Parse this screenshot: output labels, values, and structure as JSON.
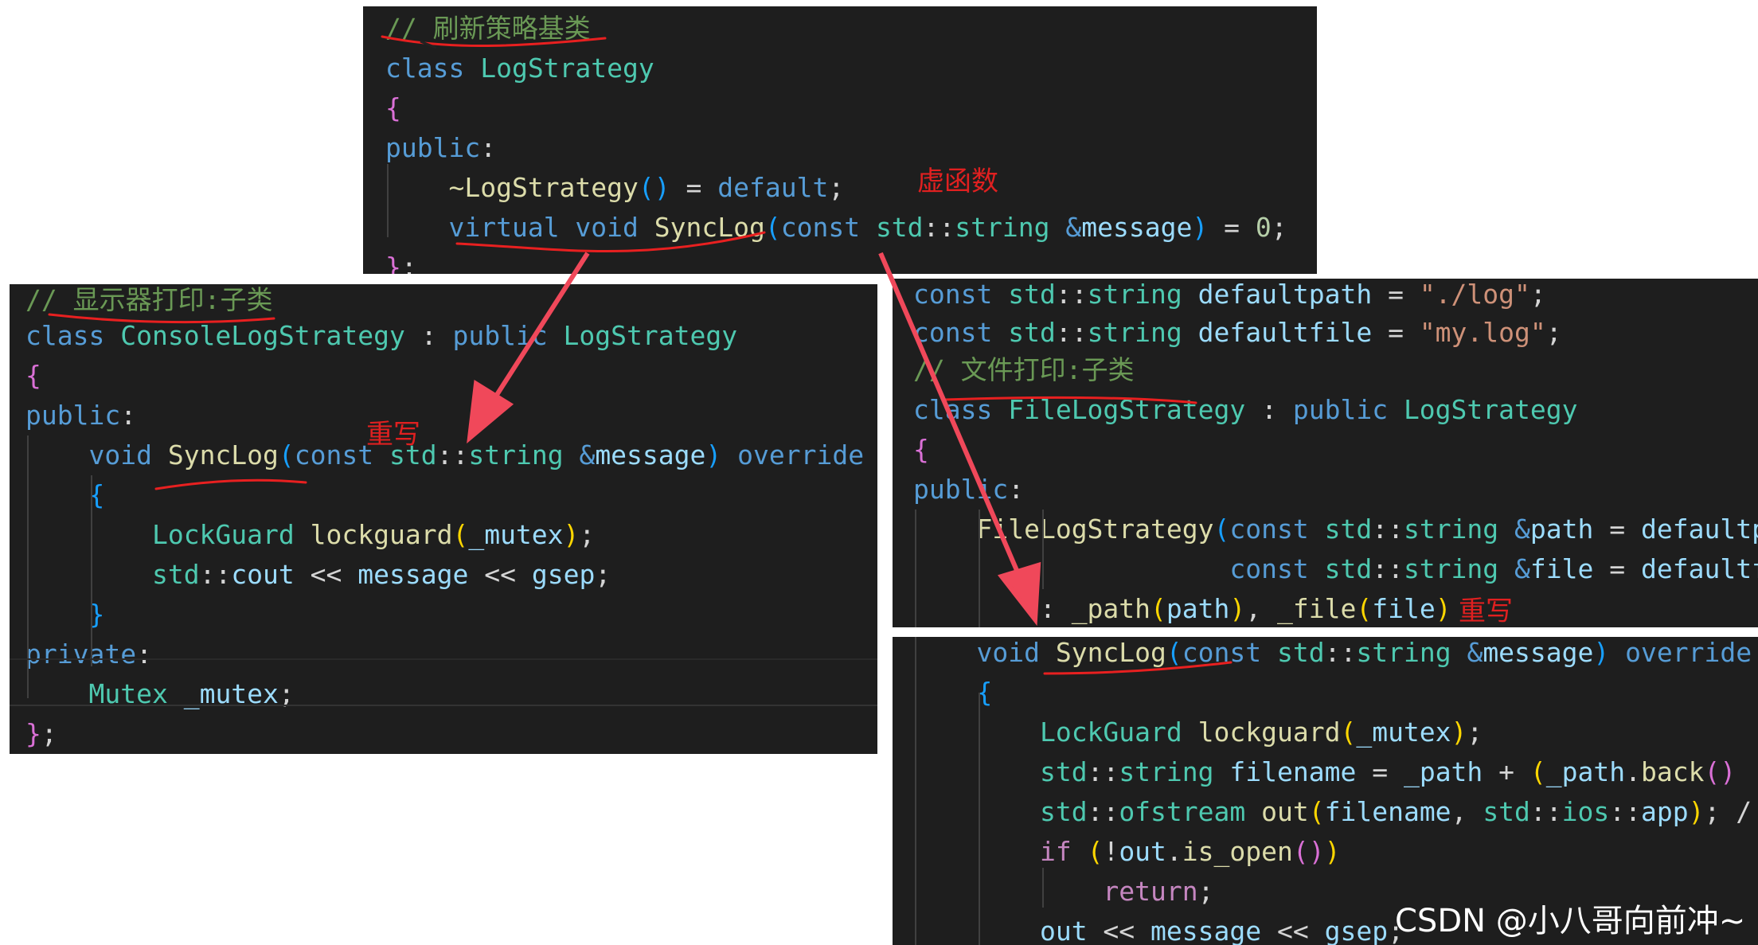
{
  "top": {
    "lines": [
      [
        [
          "cm",
          "// 刷新策略基类"
        ]
      ],
      [
        [
          "kw",
          "class "
        ],
        [
          "ty",
          "LogStrategy"
        ]
      ],
      [
        [
          "br2",
          "{"
        ]
      ],
      [
        [
          "kw",
          "public"
        ],
        [
          "pl",
          ":"
        ]
      ],
      [
        [
          "pl",
          "    "
        ],
        [
          "fn",
          "~LogStrategy"
        ],
        [
          "br3",
          "()"
        ],
        [
          "pl",
          " = "
        ],
        [
          "kw",
          "default"
        ],
        [
          "pl",
          ";"
        ]
      ],
      [
        [
          "pl",
          "    "
        ],
        [
          "kw",
          "virtual void "
        ],
        [
          "fn",
          "SyncLog"
        ],
        [
          "br3",
          "("
        ],
        [
          "kw",
          "const "
        ],
        [
          "ty",
          "std"
        ],
        [
          "pl",
          "::"
        ],
        [
          "ty",
          "string "
        ],
        [
          "kw",
          "&"
        ],
        [
          "var",
          "message"
        ],
        [
          "br3",
          ")"
        ],
        [
          "pl",
          " = "
        ],
        [
          "num",
          "0"
        ],
        [
          "pl",
          ";"
        ]
      ],
      [
        [
          "br2",
          "}"
        ],
        [
          "pl",
          ";"
        ]
      ]
    ],
    "note": "虚函数"
  },
  "left": {
    "lines": [
      [
        [
          "cm",
          "// 显示器打印:子类"
        ]
      ],
      [
        [
          "kw",
          "class "
        ],
        [
          "ty",
          "ConsoleLogStrategy "
        ],
        [
          "pl",
          ": "
        ],
        [
          "kw",
          "public "
        ],
        [
          "ty",
          "LogStrategy"
        ]
      ],
      [
        [
          "br2",
          "{"
        ]
      ],
      [
        [
          "kw",
          "public"
        ],
        [
          "pl",
          ":"
        ]
      ],
      [
        [
          "pl",
          "    "
        ],
        [
          "kw",
          "void "
        ],
        [
          "fn",
          "SyncLog"
        ],
        [
          "br3",
          "("
        ],
        [
          "kw",
          "const "
        ],
        [
          "ty",
          "std"
        ],
        [
          "pl",
          "::"
        ],
        [
          "ty",
          "string "
        ],
        [
          "kw",
          "&"
        ],
        [
          "var",
          "message"
        ],
        [
          "br3",
          ")"
        ],
        [
          "kw",
          " override"
        ]
      ],
      [
        [
          "pl",
          "    "
        ],
        [
          "br3",
          "{"
        ]
      ],
      [
        [
          "pl",
          "        "
        ],
        [
          "ty",
          "LockGuard "
        ],
        [
          "fn",
          "lockguard"
        ],
        [
          "br1",
          "("
        ],
        [
          "var",
          "_mutex"
        ],
        [
          "br1",
          ")"
        ],
        [
          "pl",
          ";"
        ]
      ],
      [
        [
          "pl",
          "        "
        ],
        [
          "ty",
          "std"
        ],
        [
          "pl",
          "::"
        ],
        [
          "var",
          "cout"
        ],
        [
          "pl",
          " << "
        ],
        [
          "var",
          "message"
        ],
        [
          "pl",
          " << "
        ],
        [
          "var",
          "gsep"
        ],
        [
          "pl",
          ";"
        ]
      ],
      [
        [
          "pl",
          "    "
        ],
        [
          "br3",
          "}"
        ]
      ],
      [
        [
          "kw",
          "private"
        ],
        [
          "pl",
          ":"
        ]
      ],
      [
        [
          "pl",
          "    "
        ],
        [
          "ty",
          "Mutex "
        ],
        [
          "var",
          "_mutex"
        ],
        [
          "pl",
          ";"
        ]
      ],
      [
        [
          "br2",
          "}"
        ],
        [
          "pl",
          ";"
        ]
      ]
    ],
    "note": "重写"
  },
  "right": {
    "lines": [
      [
        [
          "kw",
          "const "
        ],
        [
          "ty",
          "std"
        ],
        [
          "pl",
          "::"
        ],
        [
          "ty",
          "string "
        ],
        [
          "var",
          "defaultpath"
        ],
        [
          "pl",
          " = "
        ],
        [
          "str",
          "\"./log\""
        ],
        [
          "pl",
          ";"
        ]
      ],
      [
        [
          "kw",
          "const "
        ],
        [
          "ty",
          "std"
        ],
        [
          "pl",
          "::"
        ],
        [
          "ty",
          "string "
        ],
        [
          "var",
          "defaultfile"
        ],
        [
          "pl",
          " = "
        ],
        [
          "str",
          "\"my.log\""
        ],
        [
          "pl",
          ";"
        ]
      ],
      [
        [
          "cm",
          "// 文件打印:子类"
        ]
      ],
      [
        [
          "kw",
          "class "
        ],
        [
          "ty",
          "FileLogStrategy "
        ],
        [
          "pl",
          ": "
        ],
        [
          "kw",
          "public "
        ],
        [
          "ty",
          "LogStrategy"
        ]
      ],
      [
        [
          "br2",
          "{"
        ]
      ],
      [
        [
          "kw",
          "public"
        ],
        [
          "pl",
          ":"
        ]
      ],
      [
        [
          "pl",
          "    "
        ],
        [
          "fn",
          "FileLogStrategy"
        ],
        [
          "br3",
          "("
        ],
        [
          "kw",
          "const "
        ],
        [
          "ty",
          "std"
        ],
        [
          "pl",
          "::"
        ],
        [
          "ty",
          "string "
        ],
        [
          "kw",
          "&"
        ],
        [
          "var",
          "path"
        ],
        [
          "pl",
          " = "
        ],
        [
          "var",
          "defaultpath"
        ]
      ],
      [
        [
          "pl",
          "                    "
        ],
        [
          "kw",
          "const "
        ],
        [
          "ty",
          "std"
        ],
        [
          "pl",
          "::"
        ],
        [
          "ty",
          "string "
        ],
        [
          "kw",
          "&"
        ],
        [
          "var",
          "file"
        ],
        [
          "pl",
          " = "
        ],
        [
          "var",
          "defaultfile"
        ]
      ],
      [
        [
          "pl",
          "        : "
        ],
        [
          "fn",
          "_path"
        ],
        [
          "br1",
          "("
        ],
        [
          "var",
          "path"
        ],
        [
          "br1",
          ")"
        ],
        [
          "pl",
          ", "
        ],
        [
          "fn",
          "_file"
        ],
        [
          "br1",
          "("
        ],
        [
          "var",
          "file"
        ],
        [
          "br1",
          ")"
        ]
      ],
      [
        [
          "pl",
          "    "
        ],
        [
          "kw",
          "void "
        ],
        [
          "fn",
          "SyncLog"
        ],
        [
          "br3",
          "("
        ],
        [
          "kw",
          "const "
        ],
        [
          "ty",
          "std"
        ],
        [
          "pl",
          "::"
        ],
        [
          "ty",
          "string "
        ],
        [
          "kw",
          "&"
        ],
        [
          "var",
          "message"
        ],
        [
          "br3",
          ")"
        ],
        [
          "kw",
          " override"
        ]
      ],
      [
        [
          "pl",
          "    "
        ],
        [
          "br3",
          "{"
        ]
      ],
      [
        [
          "pl",
          "        "
        ],
        [
          "ty",
          "LockGuard "
        ],
        [
          "fn",
          "lockguard"
        ],
        [
          "br1",
          "("
        ],
        [
          "var",
          "_mutex"
        ],
        [
          "br1",
          ")"
        ],
        [
          "pl",
          ";"
        ]
      ],
      [
        [
          "pl",
          "        "
        ],
        [
          "ty",
          "std"
        ],
        [
          "pl",
          "::"
        ],
        [
          "ty",
          "string "
        ],
        [
          "var",
          "filename"
        ],
        [
          "pl",
          " = "
        ],
        [
          "var",
          "_path"
        ],
        [
          "pl",
          " + "
        ],
        [
          "br1",
          "("
        ],
        [
          "var",
          "_path"
        ],
        [
          "pl",
          "."
        ],
        [
          "fn",
          "back"
        ],
        [
          "br2",
          "()"
        ]
      ],
      [
        [
          "pl",
          "        "
        ],
        [
          "ty",
          "std"
        ],
        [
          "pl",
          "::"
        ],
        [
          "ty",
          "ofstream "
        ],
        [
          "fn",
          "out"
        ],
        [
          "br1",
          "("
        ],
        [
          "var",
          "filename"
        ],
        [
          "pl",
          ", "
        ],
        [
          "ty",
          "std"
        ],
        [
          "pl",
          "::"
        ],
        [
          "ty",
          "ios"
        ],
        [
          "pl",
          "::"
        ],
        [
          "var",
          "app"
        ],
        [
          "br1",
          ")"
        ],
        [
          "pl",
          "; /"
        ]
      ],
      [
        [
          "pl",
          "        "
        ],
        [
          "ctl",
          "if "
        ],
        [
          "br1",
          "("
        ],
        [
          "pl",
          "!"
        ],
        [
          "var",
          "out"
        ],
        [
          "pl",
          "."
        ],
        [
          "fn",
          "is_open"
        ],
        [
          "br2",
          "()"
        ],
        [
          "br1",
          ")"
        ]
      ],
      [
        [
          "pl",
          "            "
        ],
        [
          "ctl",
          "return"
        ],
        [
          "pl",
          ";"
        ]
      ],
      [
        [
          "pl",
          "        "
        ],
        [
          "var",
          "out"
        ],
        [
          "pl",
          " << "
        ],
        [
          "var",
          "message"
        ],
        [
          "pl",
          " << "
        ],
        [
          "var",
          "gsep"
        ],
        [
          "pl",
          ";"
        ]
      ]
    ],
    "note": "重写"
  },
  "watermark": "CSDN @小八哥向前冲~",
  "colors": {
    "panel_bg": "#1e1e1e",
    "annotation_red": "#e02020"
  }
}
